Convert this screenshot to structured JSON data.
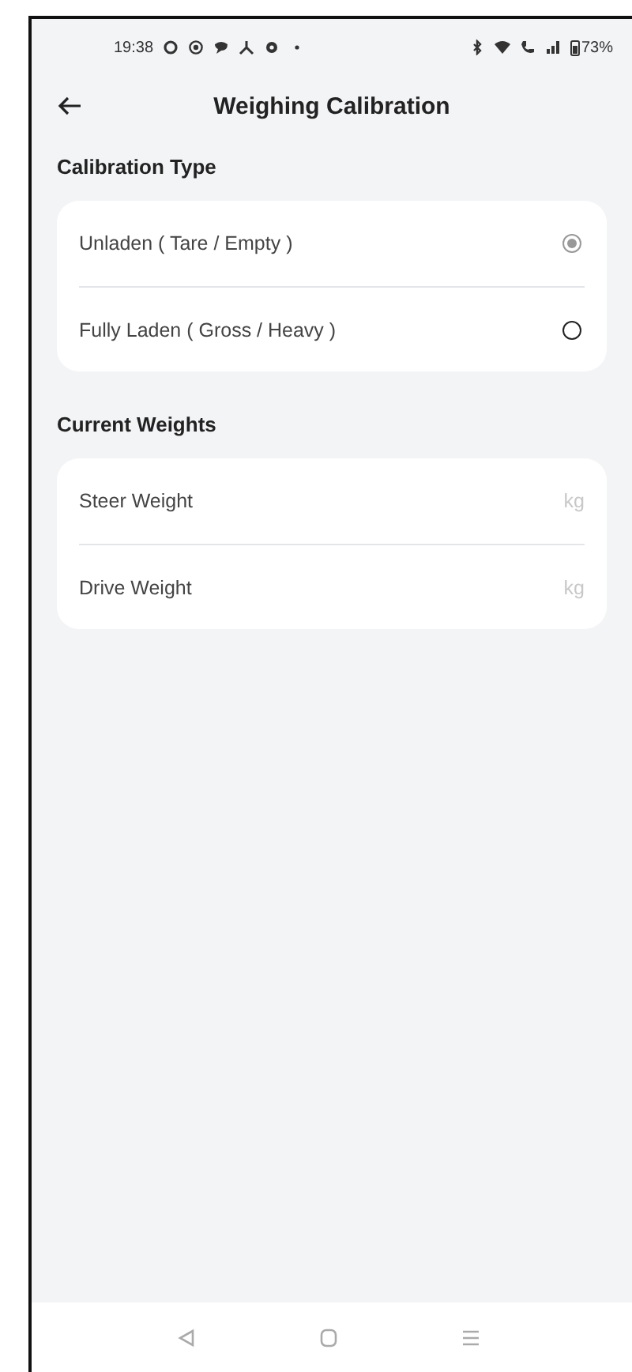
{
  "status_bar": {
    "time": "19:38",
    "battery": "73%"
  },
  "header": {
    "title": "Weighing Calibration"
  },
  "calibration_type": {
    "heading": "Calibration Type",
    "options": [
      {
        "label": "Unladen ( Tare / Empty )",
        "selected": true
      },
      {
        "label": "Fully Laden ( Gross / Heavy )",
        "selected": false
      }
    ]
  },
  "current_weights": {
    "heading": "Current Weights",
    "fields": [
      {
        "label": "Steer Weight",
        "unit": "kg"
      },
      {
        "label": "Drive Weight",
        "unit": "kg"
      }
    ]
  }
}
